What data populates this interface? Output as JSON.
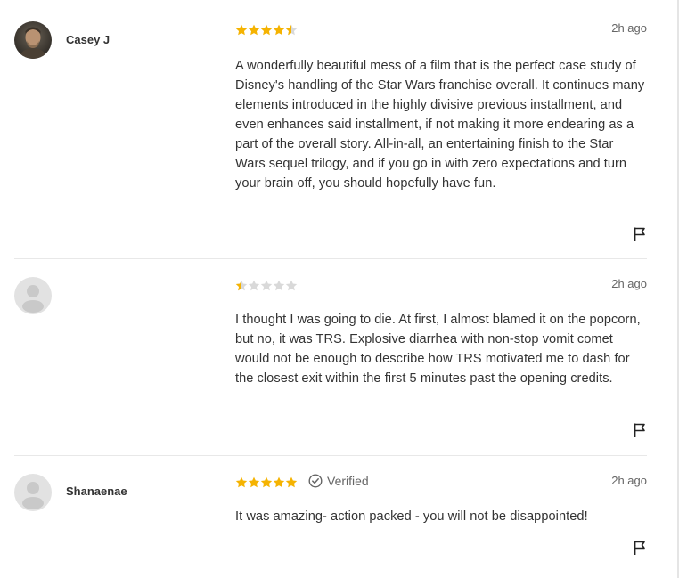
{
  "reviews": [
    {
      "author": "Casey J",
      "has_photo": true,
      "rating": 4.5,
      "verified": false,
      "time": "2h ago",
      "text": "A wonderfully beautiful mess of a film that is the perfect case study of Disney's handling of the Star Wars franchise overall. It continues many elements introduced in the highly divisive previous installment, and even enhances said installment, if not making it more endearing as a part of the overall story. All-in-all, an entertaining finish to the Star Wars sequel trilogy, and if you go in with zero expectations and turn your brain off, you should hopefully have fun."
    },
    {
      "author": "",
      "has_photo": false,
      "rating": 0.5,
      "verified": false,
      "time": "2h ago",
      "text": "I thought I was going to die. At first, I almost blamed it on the popcorn, but no, it was TRS. Explosive diarrhea with non-stop vomit comet would not be enough to describe how TRS motivated me to dash for the closest exit within the first 5 minutes past the opening credits."
    },
    {
      "author": "Shanaenae",
      "has_photo": false,
      "rating": 5,
      "verified": true,
      "verified_label": "Verified",
      "time": "2h ago",
      "text": "It was amazing- action packed - you will not be disappointed!"
    }
  ],
  "colors": {
    "star_filled": "#f5b301",
    "star_empty": "#d9d9d9",
    "avatar_placeholder": "#e0e0e0",
    "avatar_glyph": "#c8c8c8",
    "flag": "#222222"
  },
  "icons": {
    "flag": "flag-icon",
    "verified": "check-circle-icon",
    "star": "star-icon",
    "avatar_placeholder": "user-silhouette-icon"
  }
}
